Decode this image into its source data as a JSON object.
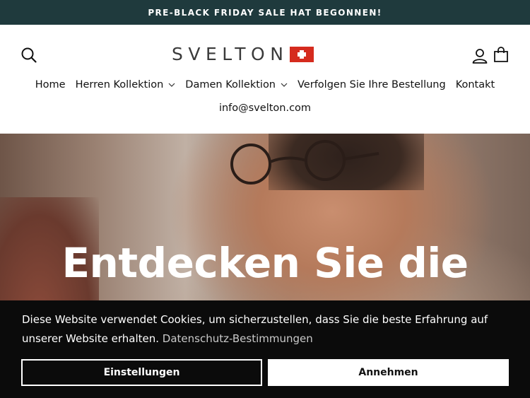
{
  "announcement": {
    "text": "PRE-BLACK FRIDAY SALE HAT BEGONNEN!"
  },
  "header": {
    "logo_text": "SVELTON",
    "search_icon": "search-icon",
    "account_icon": "user-icon",
    "cart_icon": "shopping-bag-icon"
  },
  "nav": {
    "items": [
      {
        "label": "Home"
      },
      {
        "label": "Herren Kollektion"
      },
      {
        "label": "Damen Kollektion"
      },
      {
        "label": "Verfolgen Sie Ihre Bestellung"
      },
      {
        "label": "Kontakt"
      }
    ],
    "email": "info@svelton.com"
  },
  "hero": {
    "title": "Entdecken Sie die"
  },
  "cookie": {
    "text": "Diese Website verwendet Cookies, um sicherzustellen, dass Sie die beste Erfahrung auf unserer Website erhalten.",
    "link": "Datenschutz-Bestimmungen",
    "settings_label": "Einstellungen",
    "accept_label": "Annehmen"
  },
  "colors": {
    "announcement_bg": "#1f3a3d",
    "flag_red": "#d52b1e",
    "cookie_bg": "#0b0b0b"
  }
}
